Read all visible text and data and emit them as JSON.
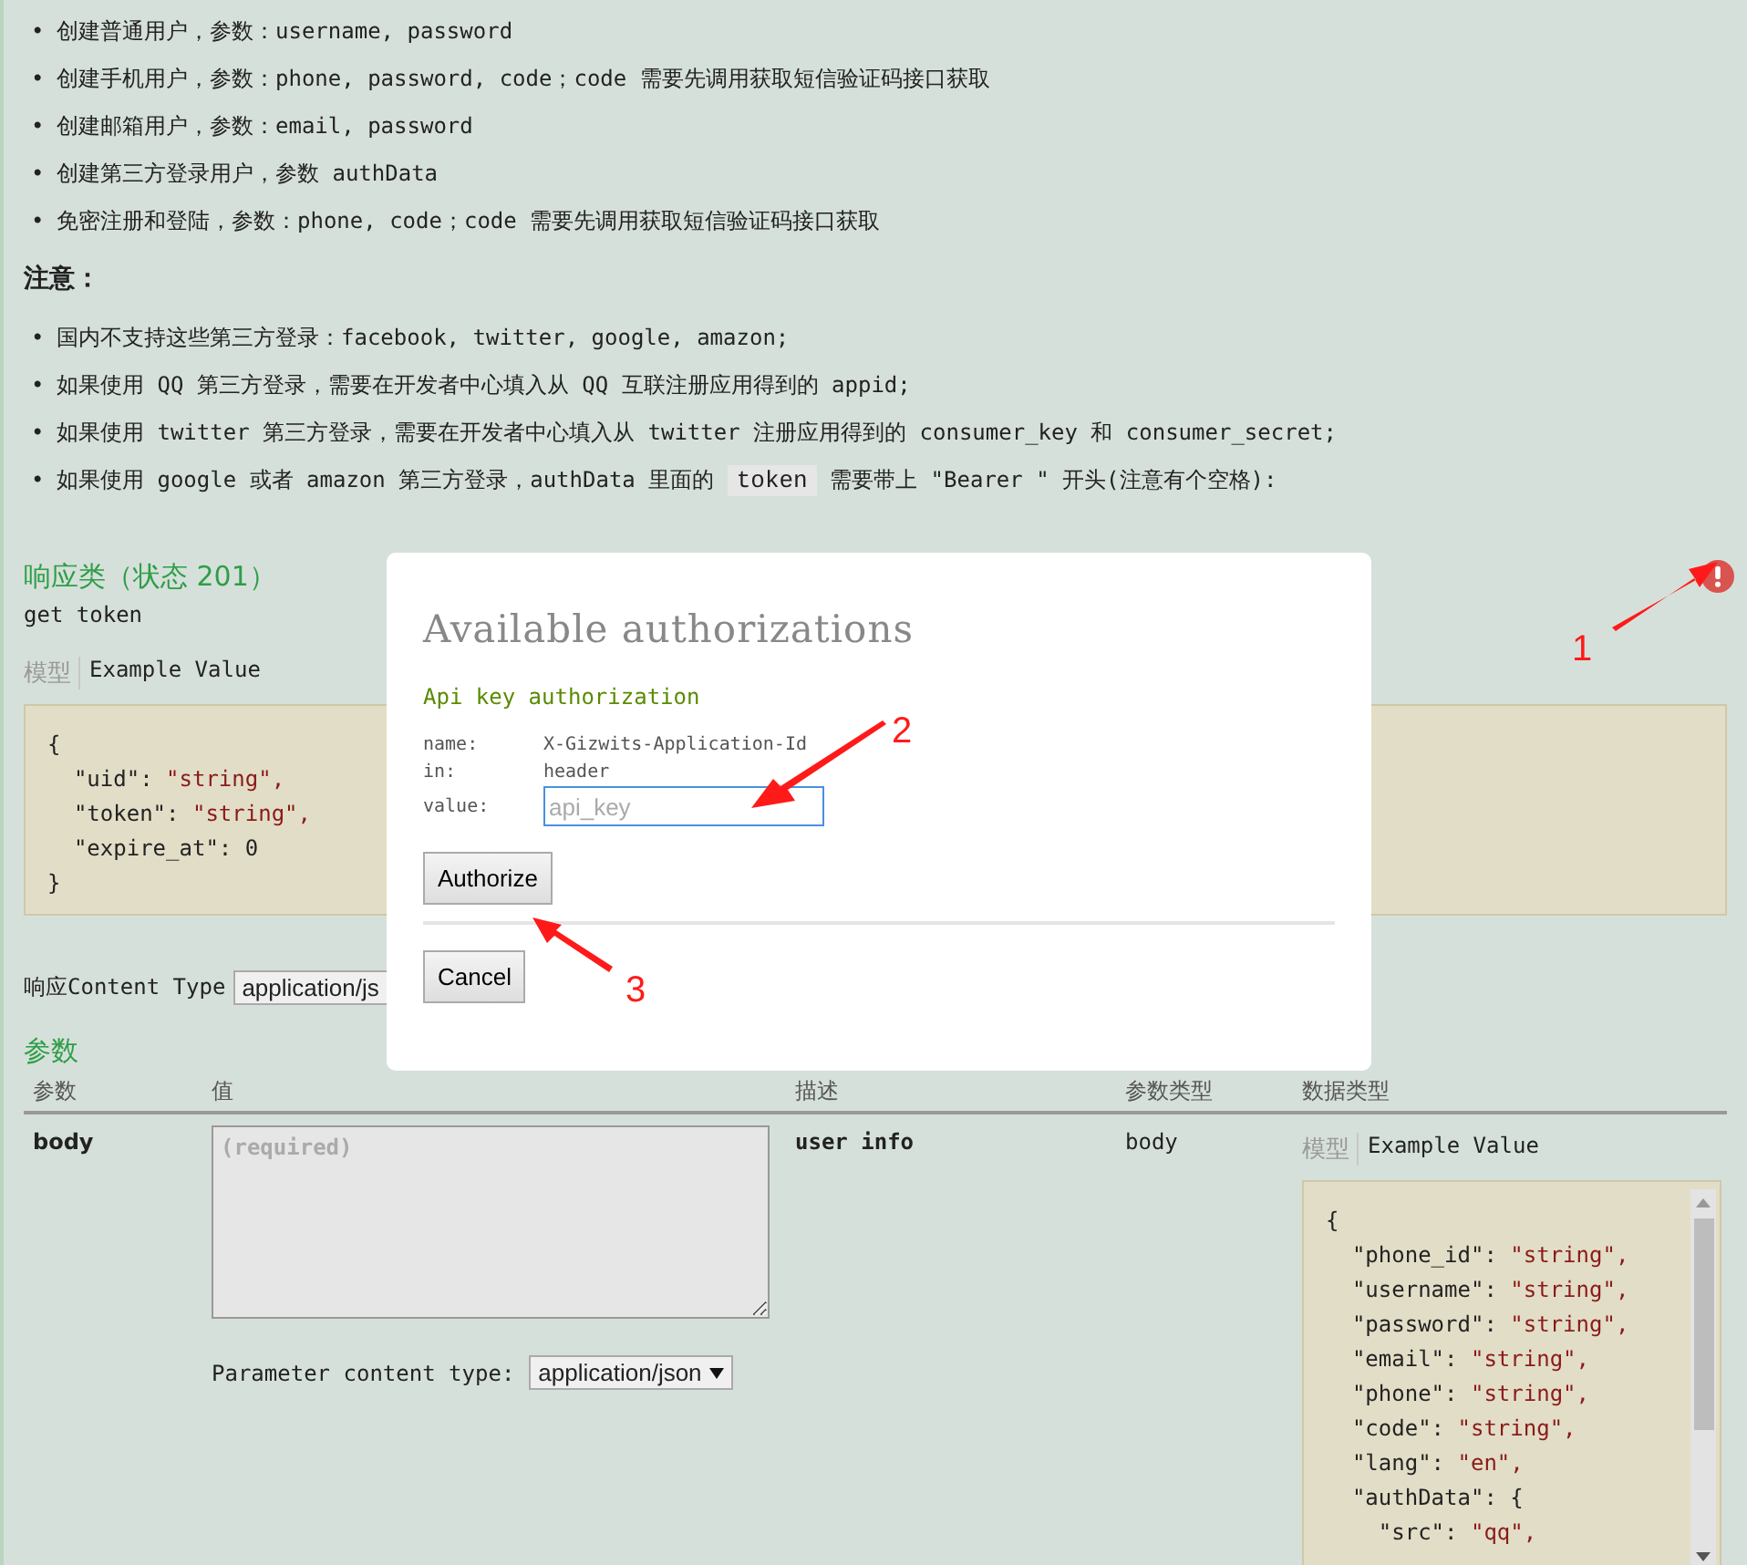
{
  "intro_items": [
    {
      "bullet": "•",
      "segments": [
        {
          "text": "创建普通用户，参数：username, password",
          "code": false
        }
      ]
    },
    {
      "bullet": "•",
      "segments": [
        {
          "text": "创建手机用户，参数：phone, password, code；code 需要先调用获取短信验证码接口获取",
          "code": false
        }
      ]
    },
    {
      "bullet": "•",
      "segments": [
        {
          "text": "创建邮箱用户，参数：email, password",
          "code": false
        }
      ]
    },
    {
      "bullet": "•",
      "segments": [
        {
          "text": "创建第三方登录用户，参数 authData",
          "code": false
        }
      ]
    },
    {
      "bullet": "•",
      "segments": [
        {
          "text": "免密注册和登陆，参数：phone, code；code 需要先调用获取短信验证码接口获取",
          "code": false
        }
      ]
    }
  ],
  "note_heading": "注意：",
  "note_items": [
    {
      "bullet": "•",
      "segments": [
        {
          "text": "国内不支持这些第三方登录：facebook, twitter, google, amazon;",
          "code": false
        }
      ]
    },
    {
      "bullet": "•",
      "segments": [
        {
          "text": "如果使用 QQ 第三方登录，需要在开发者中心填入从 QQ 互联注册应用得到的 appid;",
          "code": false
        }
      ]
    },
    {
      "bullet": "•",
      "segments": [
        {
          "text": "如果使用 twitter 第三方登录，需要在开发者中心填入从 twitter 注册应用得到的 consumer_key 和 consumer_secret;",
          "code": false
        }
      ]
    },
    {
      "bullet": "•",
      "segments": [
        {
          "text": "如果使用 google 或者 amazon 第三方登录，authData 里面的 ",
          "code": false
        },
        {
          "text": "token",
          "code": true
        },
        {
          "text": " 需要带上 \"Bearer \" 开头(注意有个空格):",
          "code": false
        }
      ]
    }
  ],
  "response": {
    "heading": "响应类（状态 201）",
    "description": "get token",
    "tabs": [
      {
        "label": "模型",
        "selected": false
      },
      {
        "label": "Example Value",
        "selected": true
      }
    ],
    "example_lines": [
      "{",
      "  \"uid\": \"string\",",
      "  \"token\": \"string\",",
      "  \"expire_at\": 0",
      "}"
    ],
    "content_type_label": "响应Content Type",
    "content_type": "application/js"
  },
  "parameters": {
    "heading": "参数",
    "columns": [
      "参数",
      "值",
      "描述",
      "参数类型",
      "数据类型"
    ],
    "rows": [
      {
        "name": "body",
        "value_placeholder": "(required)",
        "content_type_label": "Parameter content type:",
        "content_type": "application/json",
        "description": "user info",
        "param_type": "body",
        "tabs": [
          {
            "label": "模型",
            "selected": false
          },
          {
            "label": "Example Value",
            "selected": true
          }
        ],
        "example_lines": [
          "{",
          "  \"phone_id\": \"string\",",
          "  \"username\": \"string\",",
          "  \"password\": \"string\",",
          "  \"email\": \"string\",",
          "  \"phone\": \"string\",",
          "  \"code\": \"string\",",
          "  \"lang\": \"en\",",
          "  \"authData\": {",
          "    \"src\": \"qq\","
        ]
      }
    ]
  },
  "modal": {
    "title": "Available authorizations",
    "section": "Api key authorization",
    "fields": [
      {
        "label": "name:",
        "value": "X-Gizwits-Application-Id"
      },
      {
        "label": "in:",
        "value": "header"
      }
    ],
    "value_label": "value:",
    "value_placeholder": "api_key",
    "buttons": [
      "Authorize",
      "Cancel"
    ]
  },
  "annotations": [
    {
      "label": "1"
    },
    {
      "label": "2"
    },
    {
      "label": "3"
    }
  ]
}
